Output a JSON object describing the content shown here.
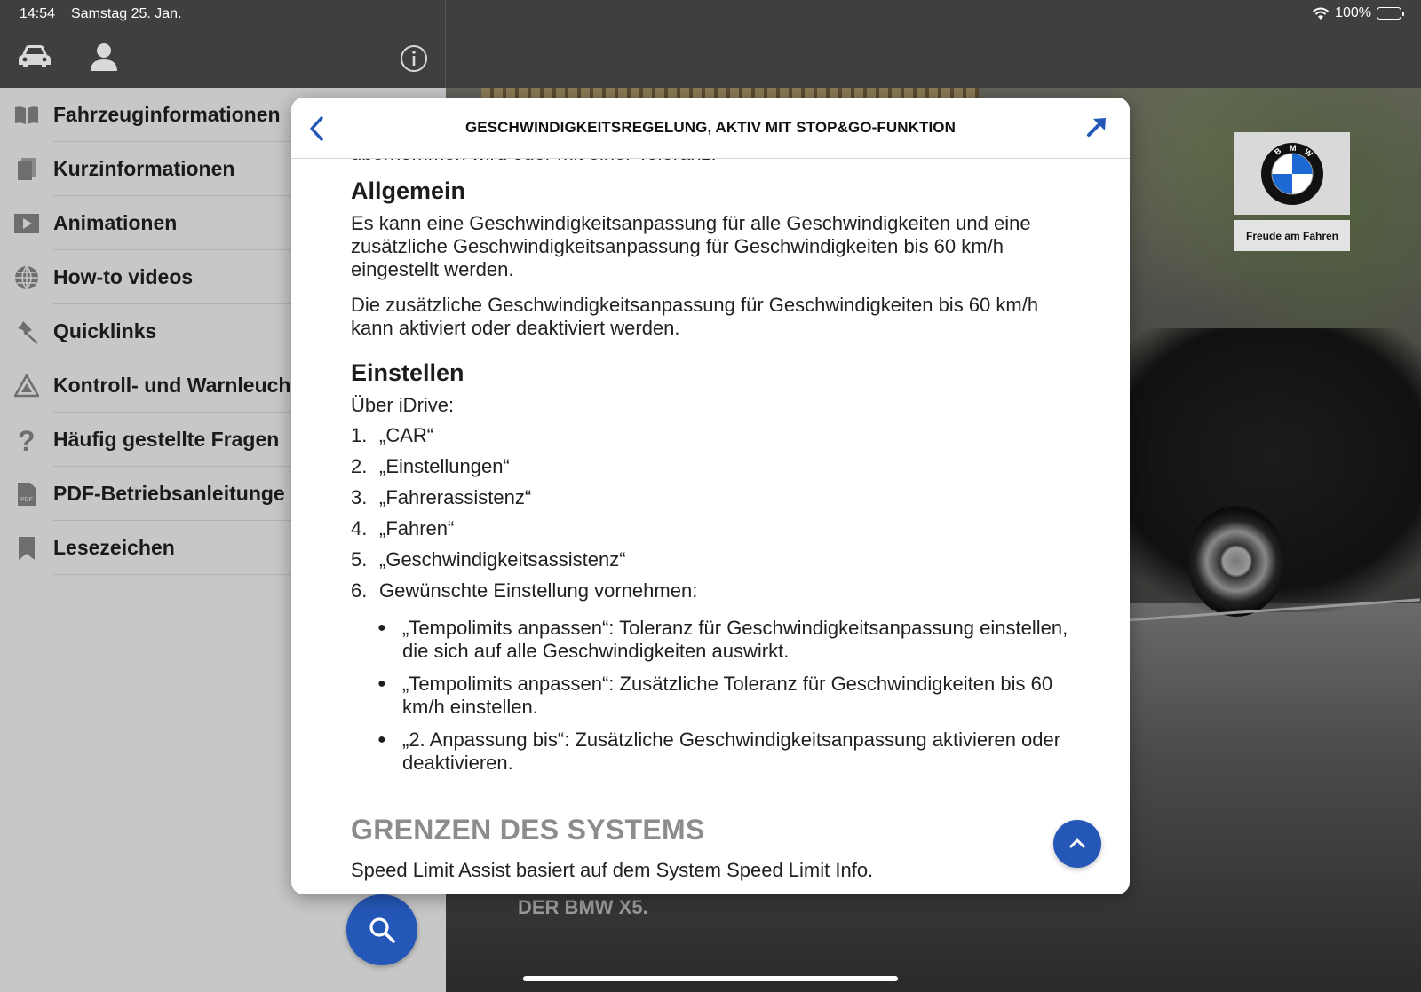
{
  "status": {
    "time": "14:54",
    "date": "Samstag 25. Jan.",
    "battery": "100%"
  },
  "sidebar": {
    "items": [
      {
        "label": "Fahrzeuginformationen",
        "icon": "book-icon"
      },
      {
        "label": "Kurzinformationen",
        "icon": "documents-icon"
      },
      {
        "label": "Animationen",
        "icon": "play-icon"
      },
      {
        "label": "How-to videos",
        "icon": "globe-icon"
      },
      {
        "label": "Quicklinks",
        "icon": "pin-icon"
      },
      {
        "label": "Kontroll- und Warnleuch",
        "icon": "warning-icon"
      },
      {
        "label": "Häufig gestellte Fragen",
        "icon": "question-icon"
      },
      {
        "label": "PDF-Betriebsanleitunge",
        "icon": "pdf-icon"
      },
      {
        "label": "Lesezeichen",
        "icon": "bookmark-icon"
      }
    ]
  },
  "hero": {
    "title": "DER BMW X5.",
    "tagline": "Freude am Fahren"
  },
  "modal": {
    "title": "GESCHWINDIGKEITSREGELUNG, AKTIV MIT STOP&GO-FUNKTION",
    "cut_line": "übernommen wird oder mit einer Toleranz.",
    "general_heading": "Allgemein",
    "general_p1": "Es kann eine Geschwindigkeitsanpassung für alle Geschwindigkeiten und eine zusätzliche Geschwindigkeitsanpassung für Geschwindigkeiten bis 60 km/h eingestellt werden.",
    "general_p2": "Die zusätzliche Geschwindigkeitsanpassung für Geschwindigkeiten bis 60 km/h kann aktiviert oder deaktiviert werden.",
    "settings_heading": "Einstellen",
    "settings_intro": "Über iDrive:",
    "steps": [
      {
        "num": "1.",
        "text": "„CAR“"
      },
      {
        "num": "2.",
        "text": "„Einstellungen“"
      },
      {
        "num": "3.",
        "text": "„Fahrerassistenz“"
      },
      {
        "num": "4.",
        "text": "„Fahren“"
      },
      {
        "num": "5.",
        "text": "„Geschwindigkeitsassistenz“"
      },
      {
        "num": "6.",
        "text": "Gewünschte Einstellung vornehmen:"
      }
    ],
    "options": [
      "„Tempolimits anpassen“: Toleranz für Geschwindigkeitsanpassung einstellen, die sich auf alle Geschwindigkeiten auswirkt.",
      "„Tempolimits anpassen“: Zusätzliche Toleranz für Geschwindigkeiten bis 60 km/h einstellen.",
      "„2. Anpassung bis“: Zusätzliche Geschwindigkeitsanpassung aktivieren oder deaktivieren."
    ],
    "limits_heading": "GRENZEN DES SYSTEMS",
    "limits_text": "Speed Limit Assist basiert auf dem System Speed Limit Info."
  },
  "colors": {
    "accent": "#2457b8",
    "sidebar_bg": "#c7c7c7",
    "topbar_bg": "#3f3f3f"
  }
}
